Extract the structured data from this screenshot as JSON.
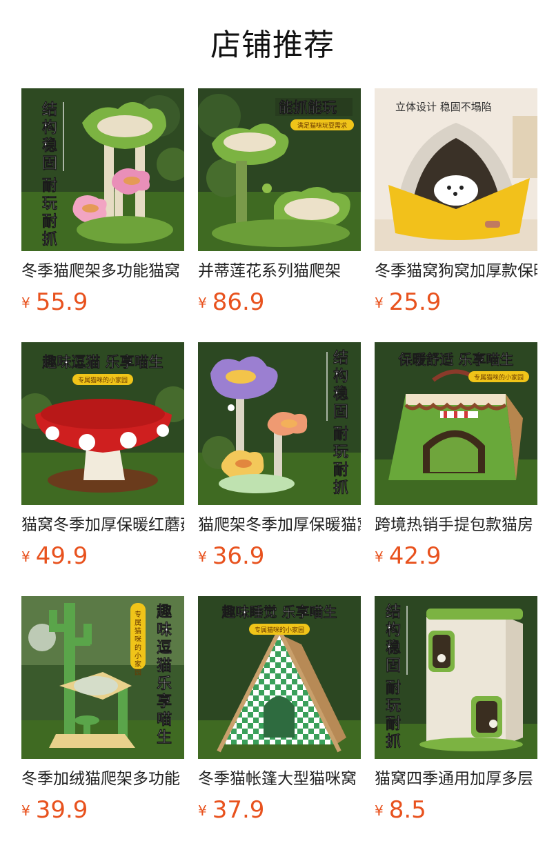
{
  "page_title": "店铺推荐",
  "currency_symbol": "¥",
  "colors": {
    "price": "#e8521e",
    "title": "#111111",
    "name": "#222222"
  },
  "products": [
    {
      "name": "冬季猫爬架多功能猫窝",
      "price": "55.9",
      "image_caption": [
        "结构稳固",
        "耐玩耐抓"
      ],
      "image_subcaption": ""
    },
    {
      "name": "并蒂莲花系列猫爬架",
      "price": "86.9",
      "image_caption": [
        "能抓能玩"
      ],
      "image_subcaption": "满足猫咪玩耍需求"
    },
    {
      "name": "冬季猫窝狗窝加厚款保暖",
      "price": "25.9",
      "image_caption": [
        "立体设计  稳固不塌陷"
      ],
      "image_subcaption": ""
    },
    {
      "name": "猫窝冬季加厚保暖红蘑菇",
      "price": "49.9",
      "image_caption": [
        "趣味逗猫 乐享喵生"
      ],
      "image_subcaption": "专属猫咪的小家园"
    },
    {
      "name": "猫爬架冬季加厚保暖猫窝",
      "price": "36.9",
      "image_caption": [
        "结构稳固",
        "耐玩耐抓"
      ],
      "image_subcaption": ""
    },
    {
      "name": "跨境热销手提包款猫房",
      "price": "42.9",
      "image_caption": [
        "保暖舒适 乐享喵生"
      ],
      "image_subcaption": "专属猫咪的小家园"
    },
    {
      "name": "冬季加绒猫爬架多功能",
      "price": "39.9",
      "image_caption": [
        "趣味逗猫",
        "乐享喵生"
      ],
      "image_subcaption": "专属猫咪的小家园"
    },
    {
      "name": "冬季猫帐篷大型猫咪窝",
      "price": "37.9",
      "image_caption": [
        "趣味睡觉 乐享喵生"
      ],
      "image_subcaption": "专属猫咪的小家园"
    },
    {
      "name": "猫窝四季通用加厚多层",
      "price": "8.5",
      "image_caption": [
        "结构稳固",
        "耐玩耐抓"
      ],
      "image_subcaption": ""
    }
  ]
}
